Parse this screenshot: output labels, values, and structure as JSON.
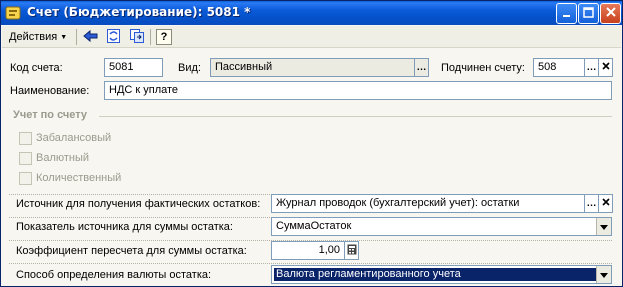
{
  "window": {
    "title": "Счет (Бюджетирование): 5081 *",
    "minimize_icon": "minimize-icon",
    "maximize_icon": "maximize-icon",
    "close_icon": "close-icon"
  },
  "toolbar": {
    "actions_label": "Действия",
    "icons": [
      "save-close-icon",
      "refresh-icon",
      "copy-icon",
      "help-icon"
    ],
    "help_glyph": "?"
  },
  "form": {
    "code": {
      "label": "Код счета:",
      "value": "5081"
    },
    "kind": {
      "label": "Вид:",
      "value": "Пассивный"
    },
    "parent": {
      "label": "Подчинен счету:",
      "value": "508"
    },
    "name": {
      "label": "Наименование:",
      "value": "НДС к уплате"
    },
    "accounting_section": {
      "title": "Учет по счету",
      "checkboxes": [
        {
          "label": "Забалансовый",
          "checked": false
        },
        {
          "label": "Валютный",
          "checked": false
        },
        {
          "label": "Количественный",
          "checked": false
        }
      ]
    },
    "balance_source": {
      "label": "Источник для получения фактических остатков:",
      "value": "Журнал проводок (бухгалтерский учет): остатки"
    },
    "source_indicator": {
      "label": "Показатель источника для суммы остатка:",
      "value": "СуммаОстаток"
    },
    "coefficient": {
      "label": "Коэффициент пересчета для суммы остатка:",
      "value": "1,00"
    },
    "currency_method": {
      "label": "Способ определения валюты остатка:",
      "value": "Валюта регламентированного учета"
    }
  },
  "colors": {
    "titlebar": "#0a5ad8",
    "selection": "#0a246a",
    "field_border": "#7f9db9"
  }
}
